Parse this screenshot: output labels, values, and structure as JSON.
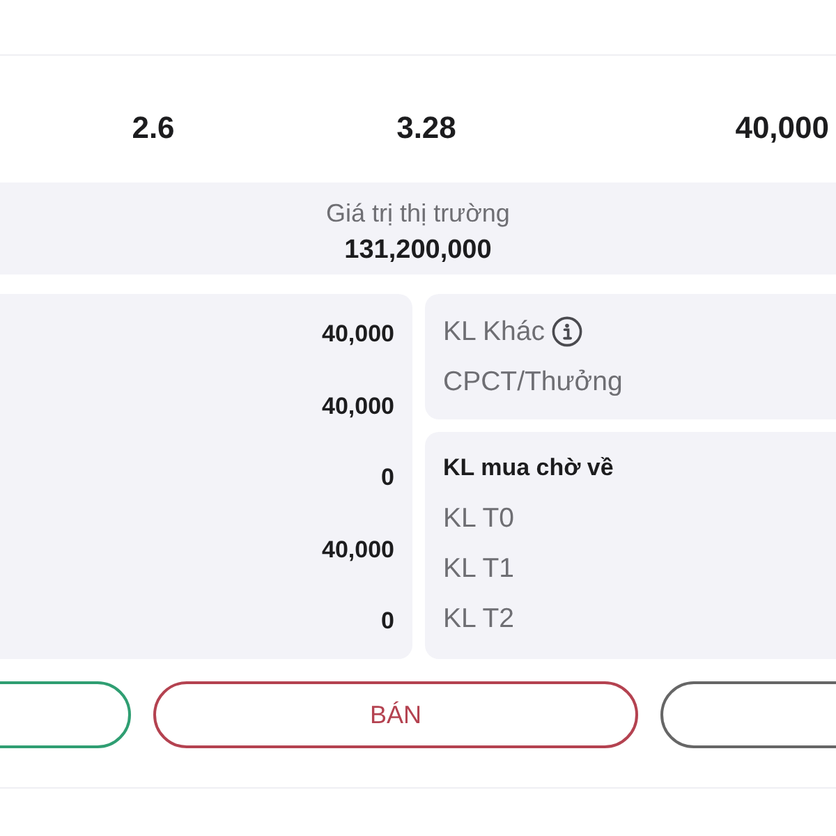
{
  "summary_row": {
    "values": [
      "2.6",
      "3.28",
      "40,000"
    ]
  },
  "market_value": {
    "label": "Giá trị thị trường",
    "value": "131,200,000"
  },
  "volumes_card": {
    "values": [
      "40,000",
      "40,000",
      "0",
      "40,000",
      "0"
    ]
  },
  "other_card": {
    "items": [
      {
        "label": "KL Khác",
        "info": true
      },
      {
        "label": "CPCT/Thưởng",
        "info": false
      }
    ]
  },
  "pending_card": {
    "title": "KL mua chờ về",
    "items": [
      "KL T0",
      "KL T1",
      "KL T2"
    ]
  },
  "buttons": [
    {
      "color": "#2f9e72"
    },
    {
      "label": "BÁN",
      "color": "#b44250"
    },
    {
      "color": "#666666"
    }
  ]
}
